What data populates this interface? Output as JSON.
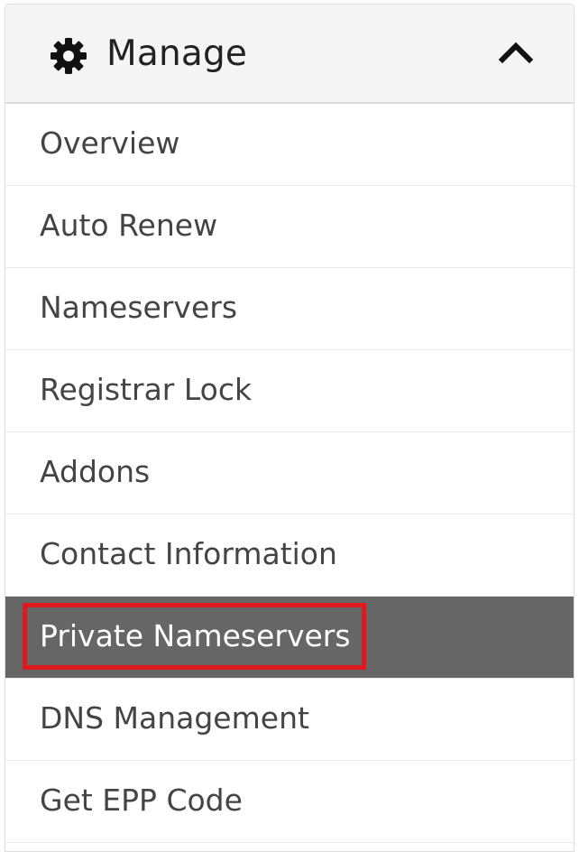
{
  "panel": {
    "title": "Manage",
    "header_icon": "gear-icon",
    "collapse_icon": "chevron-up-icon"
  },
  "menu": {
    "items": [
      {
        "label": "Overview"
      },
      {
        "label": "Auto Renew"
      },
      {
        "label": "Nameservers"
      },
      {
        "label": "Registrar Lock"
      },
      {
        "label": "Addons"
      },
      {
        "label": "Contact Information"
      },
      {
        "label": "Private Nameservers",
        "active": true
      },
      {
        "label": "DNS Management"
      },
      {
        "label": "Get EPP Code"
      }
    ]
  },
  "colors": {
    "active_bg": "#666666",
    "highlight_border": "#e0191f",
    "header_bg": "#f5f5f5",
    "text": "#444444"
  }
}
